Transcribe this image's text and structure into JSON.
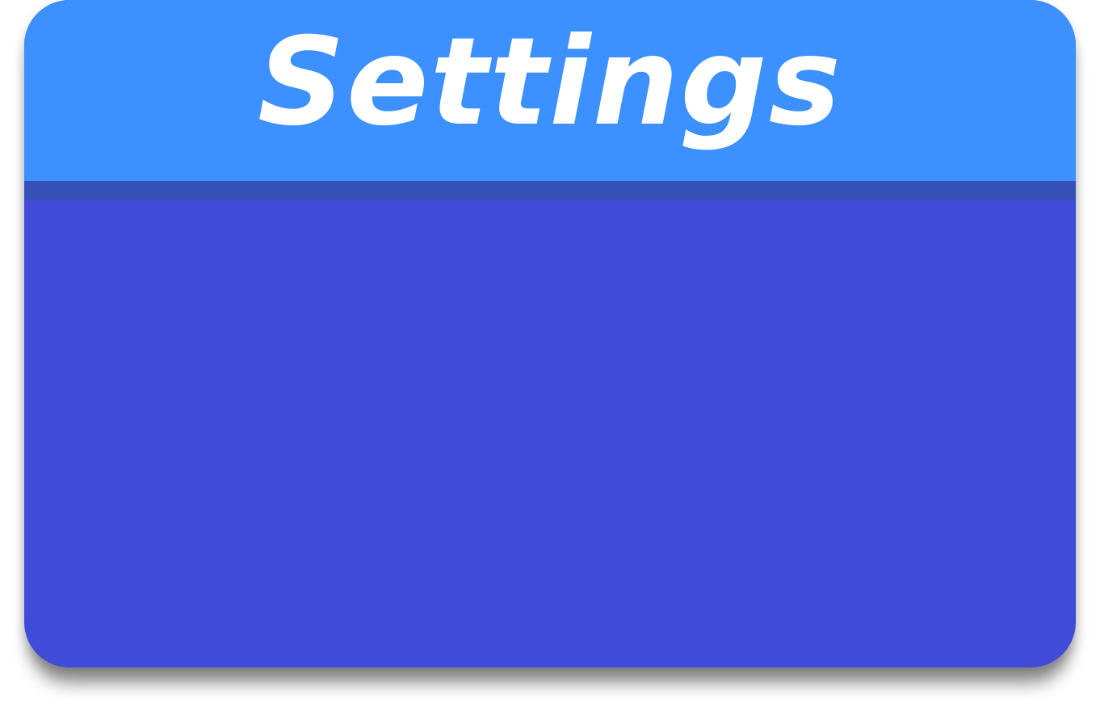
{
  "settings": {
    "title": "Settings"
  },
  "colors": {
    "header": "#3d90ff",
    "header_shadow": "#3652b8",
    "body": "#404bd9",
    "title_text": "#ffffff"
  }
}
